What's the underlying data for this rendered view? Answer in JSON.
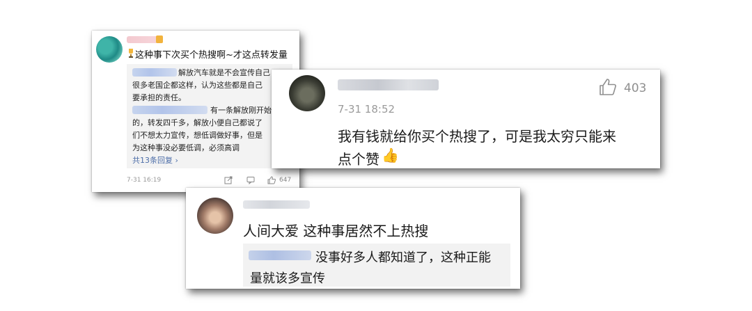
{
  "card1": {
    "title": "这种事下次买个热搜啊~才这点转发量",
    "reply_lines": [
      "解放汽车就是不会宣传自己",
      "很多老国企都这样，认为这些都是自己",
      "要承担的责任。",
      "有一条解放刚开始",
      "的，转发四千多，解放小便自己都说了",
      "们不想太力宣传，想低调做好事，但是",
      "为这种事没必要低调，必须高调"
    ],
    "more_replies": "共13条回复 ›",
    "time": "7-31 16:19",
    "likes": "647",
    "icons": [
      "trophy-icon",
      "share-icon",
      "comment-icon",
      "like-icon"
    ]
  },
  "card2": {
    "time": "7-31 18:52",
    "likes": "403",
    "text_line1": "我有钱就给你买个热搜了，可是我太穷只能来",
    "text_line2": "点个赞",
    "emoji": "👍",
    "icons": [
      "like-icon"
    ]
  },
  "card3": {
    "text": "人间大爱 这种事居然不上热搜",
    "reply_line1": "没事好多人都知道了，这种正能",
    "reply_line2": "量就该多宣传"
  },
  "colors": {
    "link": "#4d6ea8",
    "meta": "#999999",
    "reply_bg": "#f2f2f2"
  }
}
